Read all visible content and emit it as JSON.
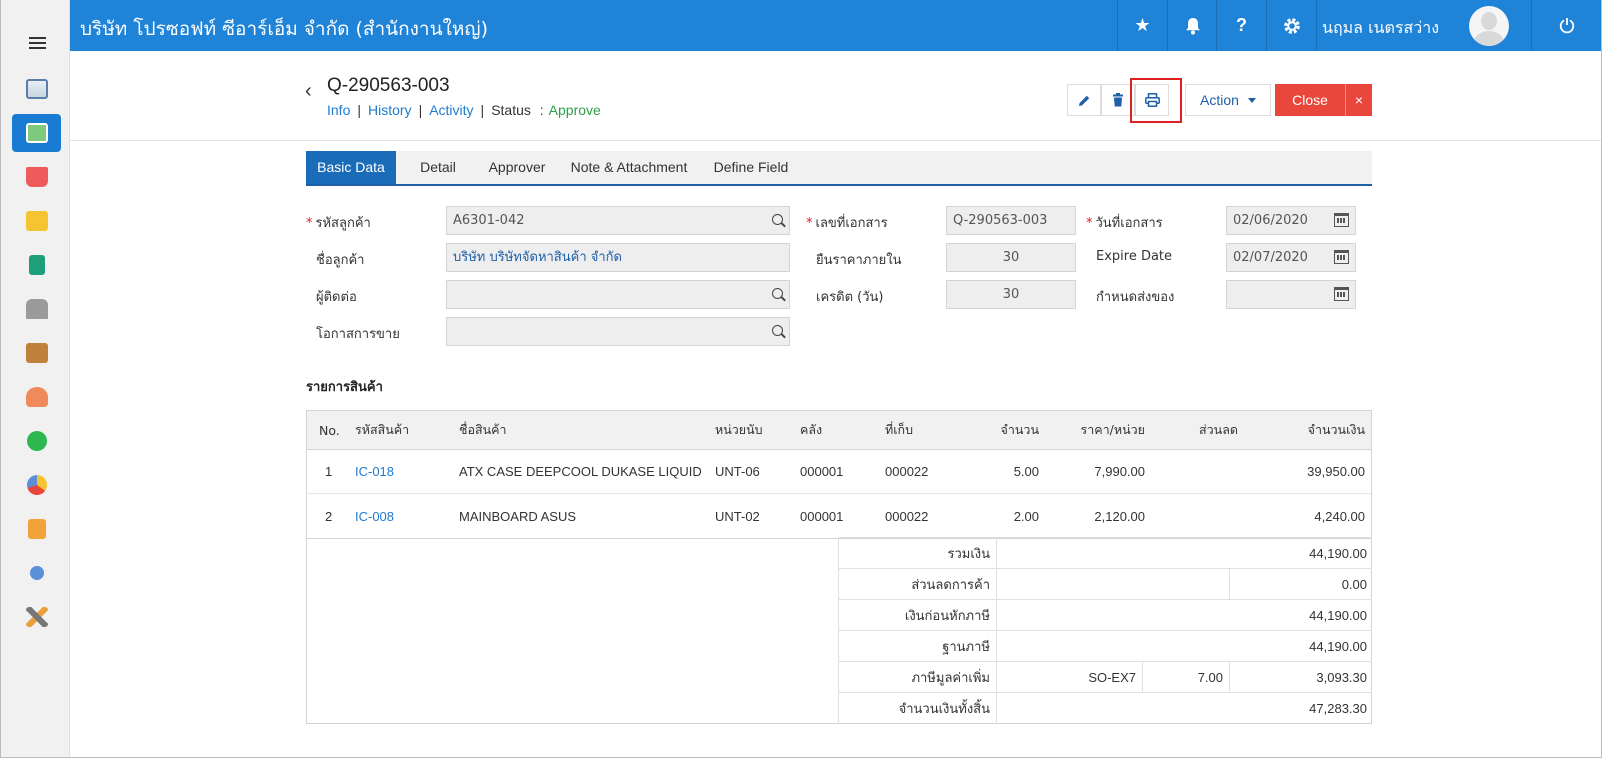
{
  "header": {
    "company": "บริษัท โปรซอฟท์ ซีอาร์เอ็ม จำกัด (สำนักงานใหญ่)",
    "user_name": "นฤมล เนตรสว่าง"
  },
  "document": {
    "title": "Q-290563-003",
    "links": {
      "info": "Info",
      "history": "History",
      "activity": "Activity"
    },
    "status_label": "Status",
    "status_colon": ":",
    "status_value": "Approve",
    "sep": "|"
  },
  "buttons": {
    "action": "Action",
    "close": "Close",
    "close_x": "×"
  },
  "tabs": [
    "Basic Data",
    "Detail",
    "Approver",
    "Note & Attachment",
    "Define Field"
  ],
  "form": {
    "customer_code_label": "รหัสลูกค้า",
    "customer_code": "A6301-042",
    "customer_name_label": "ชื่อลูกค้า",
    "customer_name": "บริษัท บริษัทจัดหาสินค้า จำกัด",
    "contact_label": "ผู้ติดต่อ",
    "contact": "",
    "opportunity_label": "โอกาสการขาย",
    "opportunity": "",
    "doc_no_label": "เลขที่เอกสาร",
    "doc_no": "Q-290563-003",
    "price_valid_label": "ยืนราคาภายใน",
    "price_valid": "30",
    "credit_label": "เครดิต (วัน)",
    "credit": "30",
    "doc_date_label": "วันที่เอกสาร",
    "doc_date": "02/06/2020",
    "expire_label": "Expire Date",
    "expire": "02/07/2020",
    "delivery_label": "กำหนดส่งของ",
    "delivery": "",
    "required_mark": "*"
  },
  "items_section_title": "รายการสินค้า",
  "table": {
    "headers": [
      "No.",
      "รหัสสินค้า",
      "ชื่อสินค้า",
      "หน่วยนับ",
      "คลัง",
      "ที่เก็บ",
      "จำนวน",
      "ราคา/หน่วย",
      "ส่วนลด",
      "จำนวนเงิน"
    ],
    "rows": [
      [
        "1",
        "IC-018",
        "ATX CASE DEEPCOOL DUKASE LIQUID",
        "UNT-06",
        "000001",
        "000022",
        "5.00",
        "7,990.00",
        "",
        "39,950.00"
      ],
      [
        "2",
        "IC-008",
        "MAINBOARD ASUS",
        "UNT-02",
        "000001",
        "000022",
        "2.00",
        "2,120.00",
        "",
        "4,240.00"
      ]
    ]
  },
  "summary": {
    "total_label": "รวมเงิน",
    "total": "44,190.00",
    "discount_label": "ส่วนลดการค้า",
    "discount": "",
    "discount_amount": "0.00",
    "before_tax_label": "เงินก่อนหักภาษี",
    "before_tax": "44,190.00",
    "tax_base_label": "ฐานภาษี",
    "tax_base": "44,190.00",
    "vat_label": "ภาษีมูลค่าเพิ่ม",
    "vat_code": "SO-EX7",
    "vat_rate": "7.00",
    "vat_amount": "3,093.30",
    "grand_total_label": "จำนวนเงินทั้งสิ้น",
    "grand_total": "47,283.30"
  },
  "colors": {
    "primary": "#1f83d8",
    "danger": "#e9463c",
    "approve": "#2ca04a",
    "link": "#1f7bd0"
  }
}
